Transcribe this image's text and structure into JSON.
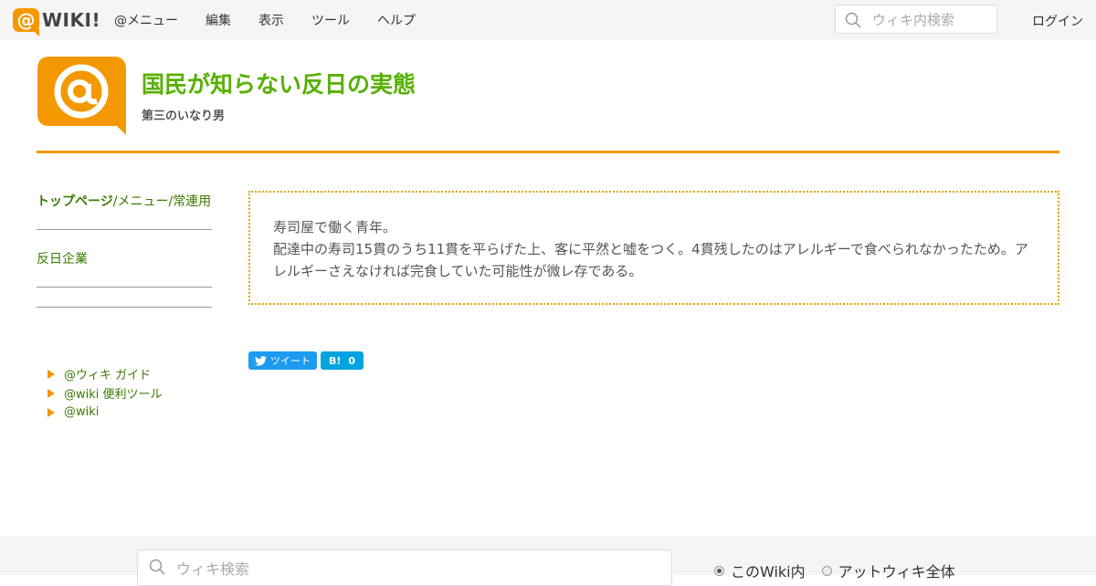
{
  "topbar": {
    "logo_text": "WIKI!",
    "menu": [
      "@メニュー",
      "編集",
      "表示",
      "ツール",
      "ヘルプ"
    ],
    "search_placeholder": "ウィキ内検索",
    "login": "ログイン"
  },
  "site": {
    "title": "国民が知らない反日の実態",
    "subtitle": "第三のいなり男"
  },
  "sidebar": {
    "top_page": "トップページ",
    "path_rest": "/メニュー/常連用",
    "item": "反日企業",
    "links": [
      "@ウィキ ガイド",
      "@wiki 便利ツール",
      "@wiki"
    ]
  },
  "content": {
    "line1": "寿司屋で働く青年。",
    "line2": "配達中の寿司15貫のうち11貫を平らげた上、客に平然と嘘をつく。4貫残したのはアレルギーで食べられなかったため。アレルギーさえなければ完食していた可能性が微レ存である。"
  },
  "share": {
    "tweet": "ツイート",
    "hatena_label": "B!",
    "hatena_count": "0"
  },
  "footer": {
    "search_placeholder": "ウィキ検索",
    "radio_options": [
      "このWiki内",
      "アットウィキ全体"
    ]
  },
  "colors": {
    "accent": "#f39800",
    "title_green": "#58b000",
    "link_green": "#3a7a00"
  }
}
